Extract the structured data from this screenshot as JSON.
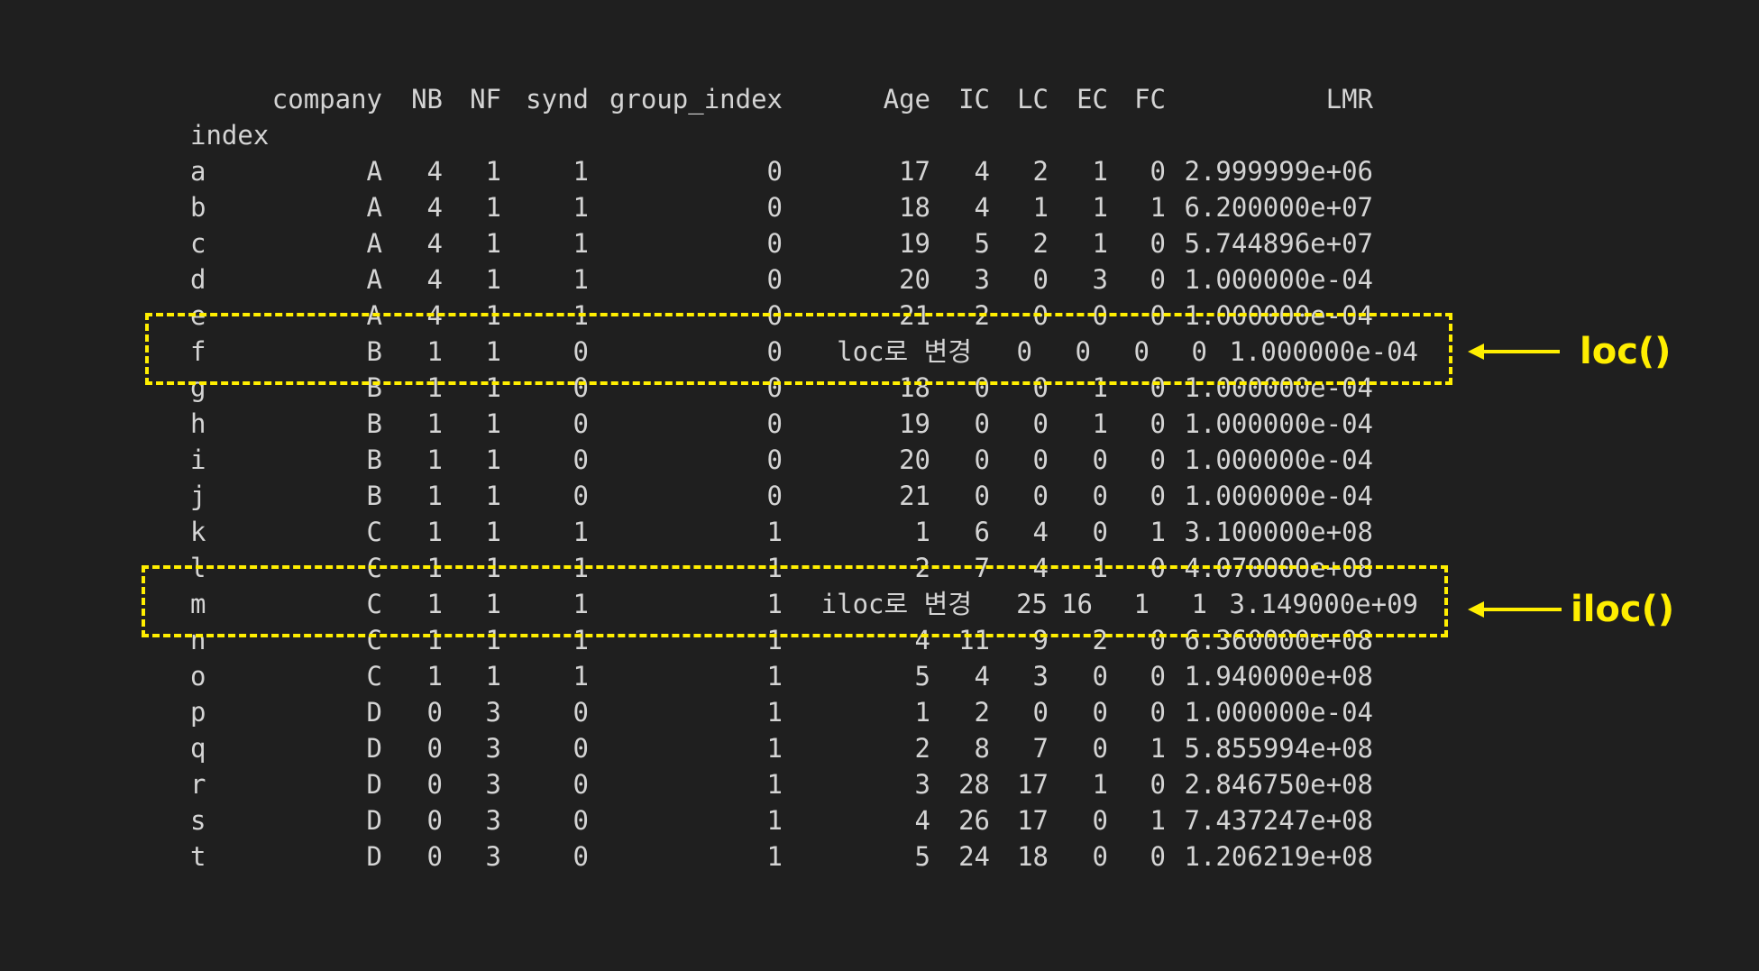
{
  "table": {
    "index_label": "index",
    "columns": [
      "company",
      "NB",
      "NF",
      "synd",
      "group_index",
      "Age",
      "IC",
      "LC",
      "EC",
      "FC",
      "LMR"
    ],
    "rows": [
      {
        "index": "a",
        "values": [
          "A",
          "4",
          "1",
          "1",
          "0",
          "17",
          "4",
          "2",
          "1",
          "0",
          "2.999999e+06"
        ]
      },
      {
        "index": "b",
        "values": [
          "A",
          "4",
          "1",
          "1",
          "0",
          "18",
          "4",
          "1",
          "1",
          "1",
          "6.200000e+07"
        ]
      },
      {
        "index": "c",
        "values": [
          "A",
          "4",
          "1",
          "1",
          "0",
          "19",
          "5",
          "2",
          "1",
          "0",
          "5.744896e+07"
        ]
      },
      {
        "index": "d",
        "values": [
          "A",
          "4",
          "1",
          "1",
          "0",
          "20",
          "3",
          "0",
          "3",
          "0",
          "1.000000e-04"
        ]
      },
      {
        "index": "e",
        "values": [
          "A",
          "4",
          "1",
          "1",
          "0",
          "21",
          "2",
          "0",
          "0",
          "0",
          "1.000000e-04"
        ]
      },
      {
        "index": "f",
        "values": [
          "B",
          "1",
          "1",
          "0",
          "0",
          "loc로 변경",
          "0",
          "0",
          "0",
          "0",
          "1.000000e-04"
        ]
      },
      {
        "index": "g",
        "values": [
          "B",
          "1",
          "1",
          "0",
          "0",
          "18",
          "0",
          "0",
          "1",
          "0",
          "1.000000e-04"
        ]
      },
      {
        "index": "h",
        "values": [
          "B",
          "1",
          "1",
          "0",
          "0",
          "19",
          "0",
          "0",
          "1",
          "0",
          "1.000000e-04"
        ]
      },
      {
        "index": "i",
        "values": [
          "B",
          "1",
          "1",
          "0",
          "0",
          "20",
          "0",
          "0",
          "0",
          "0",
          "1.000000e-04"
        ]
      },
      {
        "index": "j",
        "values": [
          "B",
          "1",
          "1",
          "0",
          "0",
          "21",
          "0",
          "0",
          "0",
          "0",
          "1.000000e-04"
        ]
      },
      {
        "index": "k",
        "values": [
          "C",
          "1",
          "1",
          "1",
          "1",
          "1",
          "6",
          "4",
          "0",
          "1",
          "3.100000e+08"
        ]
      },
      {
        "index": "l",
        "values": [
          "C",
          "1",
          "1",
          "1",
          "1",
          "2",
          "7",
          "4",
          "1",
          "0",
          "4.070000e+08"
        ]
      },
      {
        "index": "m",
        "values": [
          "C",
          "1",
          "1",
          "1",
          "1",
          "iloc로 변경",
          "25",
          "16",
          "1",
          "1",
          "3.149000e+09"
        ]
      },
      {
        "index": "n",
        "values": [
          "C",
          "1",
          "1",
          "1",
          "1",
          "4",
          "11",
          "9",
          "2",
          "0",
          "6.360000e+08"
        ]
      },
      {
        "index": "o",
        "values": [
          "C",
          "1",
          "1",
          "1",
          "1",
          "5",
          "4",
          "3",
          "0",
          "0",
          "1.940000e+08"
        ]
      },
      {
        "index": "p",
        "values": [
          "D",
          "0",
          "3",
          "0",
          "1",
          "1",
          "2",
          "0",
          "0",
          "0",
          "1.000000e-04"
        ]
      },
      {
        "index": "q",
        "values": [
          "D",
          "0",
          "3",
          "0",
          "1",
          "2",
          "8",
          "7",
          "0",
          "1",
          "5.855994e+08"
        ]
      },
      {
        "index": "r",
        "values": [
          "D",
          "0",
          "3",
          "0",
          "1",
          "3",
          "28",
          "17",
          "1",
          "0",
          "2.846750e+08"
        ]
      },
      {
        "index": "s",
        "values": [
          "D",
          "0",
          "3",
          "0",
          "1",
          "4",
          "26",
          "17",
          "0",
          "1",
          "7.437247e+08"
        ]
      },
      {
        "index": "t",
        "values": [
          "D",
          "0",
          "3",
          "0",
          "1",
          "5",
          "24",
          "18",
          "0",
          "0",
          "1.206219e+08"
        ]
      }
    ]
  },
  "annotations": [
    {
      "label": "loc()",
      "row": "f"
    },
    {
      "label": "iloc()",
      "row": "m"
    }
  ],
  "colors": {
    "background": "#1f1f1f",
    "text": "#d4d4d4",
    "highlight": "#ffee00"
  }
}
